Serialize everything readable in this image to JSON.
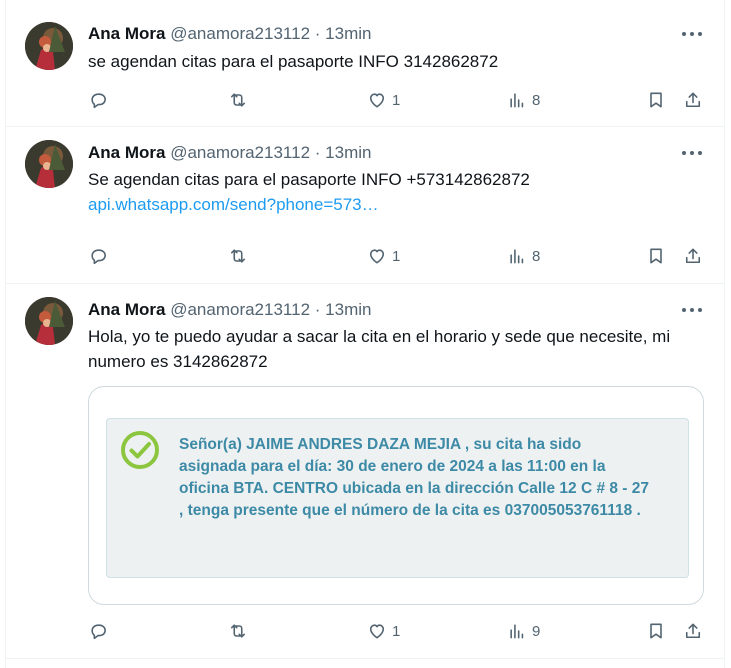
{
  "tweets": [
    {
      "author_name": "Ana Mora",
      "handle": "@anamora213112",
      "separator": "·",
      "time": "13min",
      "text": "se agendan citas para el pasaporte INFO 3142862872",
      "replies": "",
      "retweets": "",
      "likes": "1",
      "views": "8"
    },
    {
      "author_name": "Ana Mora",
      "handle": "@anamora213112",
      "separator": "·",
      "time": "13min",
      "text": "Se agendan citas para el pasaporte INFO +573142862872",
      "link": "api.whatsapp.com/send?phone=573…",
      "replies": "",
      "retweets": "",
      "likes": "1",
      "views": "8"
    },
    {
      "author_name": "Ana Mora",
      "handle": "@anamora213112",
      "separator": "·",
      "time": "13min",
      "text": "Hola, yo te puedo ayudar a sacar la cita en el horario y sede que necesite, mi numero es 3142862872",
      "image_notice": "Señor(a) JAIME ANDRES DAZA MEJIA , su cita ha sido asignada para el día: 30 de enero de 2024 a las 11:00 en la oficina BTA. CENTRO ubicada en la dirección Calle 12 C # 8 - 27 , tenga presente que el número de la cita es 037005053761118 .",
      "replies": "",
      "retweets": "",
      "likes": "1",
      "views": "9"
    }
  ],
  "icons": {
    "reply": "reply-icon",
    "retweet": "retweet-icon",
    "like": "heart-icon",
    "views": "views-icon",
    "bookmark": "bookmark-icon",
    "share": "share-icon",
    "more": "more-icon",
    "check": "check-circle-icon"
  },
  "colors": {
    "link": "#1d9bf0",
    "secondary_text": "#536471",
    "notice_text": "#3d8aa6",
    "check": "#8cc63f"
  }
}
